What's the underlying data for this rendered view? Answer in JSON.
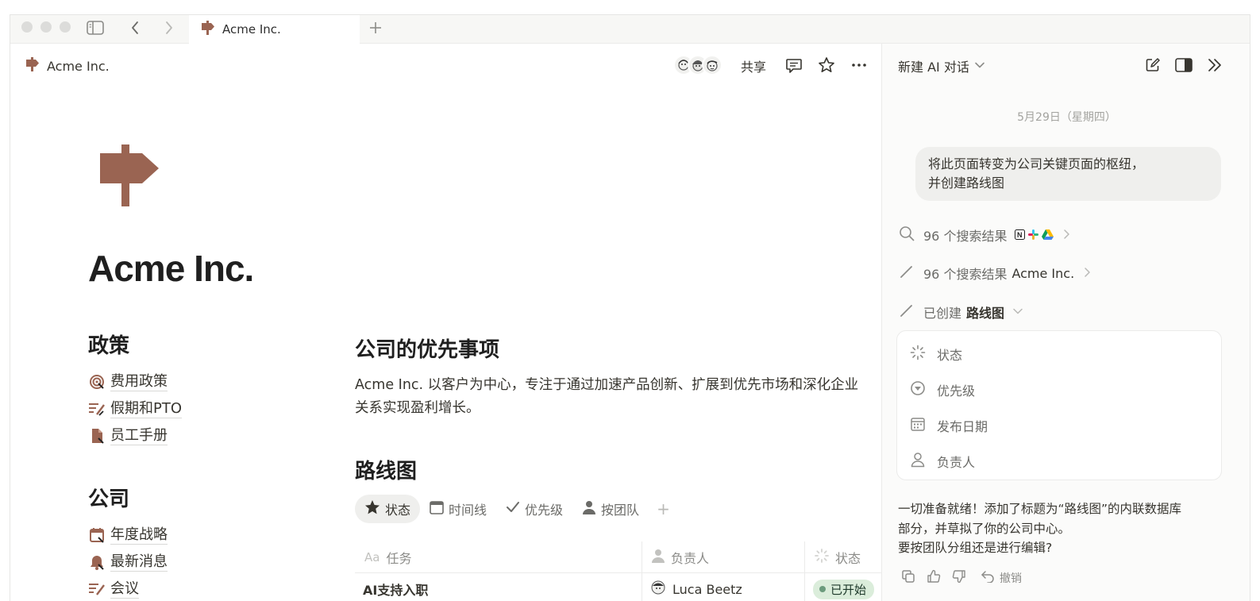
{
  "tabbar": {
    "tab_title": "Acme Inc."
  },
  "page": {
    "breadcrumb": "Acme Inc.",
    "share_label": "共享",
    "title": "Acme Inc.",
    "accent_color": "#9a6452"
  },
  "left_sections": [
    {
      "heading": "政策",
      "items": [
        {
          "icon": "target-icon",
          "label": "费用政策"
        },
        {
          "icon": "edit-list-icon",
          "label": "假期和PTO"
        },
        {
          "icon": "document-icon",
          "label": "员工手册"
        }
      ]
    },
    {
      "heading": "公司",
      "items": [
        {
          "icon": "calendar-icon",
          "label": "年度战略"
        },
        {
          "icon": "bell-icon",
          "label": "最新消息"
        },
        {
          "icon": "edit-list-icon",
          "label": "会议"
        }
      ]
    }
  ],
  "priorities": {
    "heading": "公司的优先事项",
    "text": "Acme Inc. 以客户为中心，专注于通过加速产品创新、扩展到优先市场和深化企业关系实现盈利增长。"
  },
  "roadmap": {
    "heading": "路线图",
    "views": [
      {
        "icon": "star-icon",
        "label": "状态",
        "active": true
      },
      {
        "icon": "calendar-icon",
        "label": "时间线",
        "active": false
      },
      {
        "icon": "check-icon",
        "label": "优先级",
        "active": false
      },
      {
        "icon": "person-icon",
        "label": "按团队",
        "active": false
      }
    ],
    "columns": {
      "task": "任务",
      "owner": "负责人",
      "status": "状态",
      "task_prefix": "Aa"
    },
    "rows": [
      {
        "task": "AI支持入职",
        "owner": "Luca Beetz",
        "status": "已开始"
      }
    ]
  },
  "ai_panel": {
    "title": "新建 AI 对话",
    "date": "5月29日（星期四）",
    "user_message_line1": "将此页面转变为公司关键页面的枢纽，",
    "user_message_line2": "并创建路线图",
    "step1": "96 个搜索结果",
    "step2_prefix": "96 个搜索结果",
    "step2_target": "Acme Inc.",
    "step3_prefix": "已创建",
    "step3_target": "路线图",
    "properties": [
      "状态",
      "优先级",
      "发布日期",
      "负责人"
    ],
    "reply_line1": "一切准备就绪！添加了标题为“路线图”的内联数据库",
    "reply_line2": "部分，并草拟了你的公司中心。",
    "reply_line3": "要按团队分组还是进行编辑?",
    "undo_label": "撤销"
  }
}
